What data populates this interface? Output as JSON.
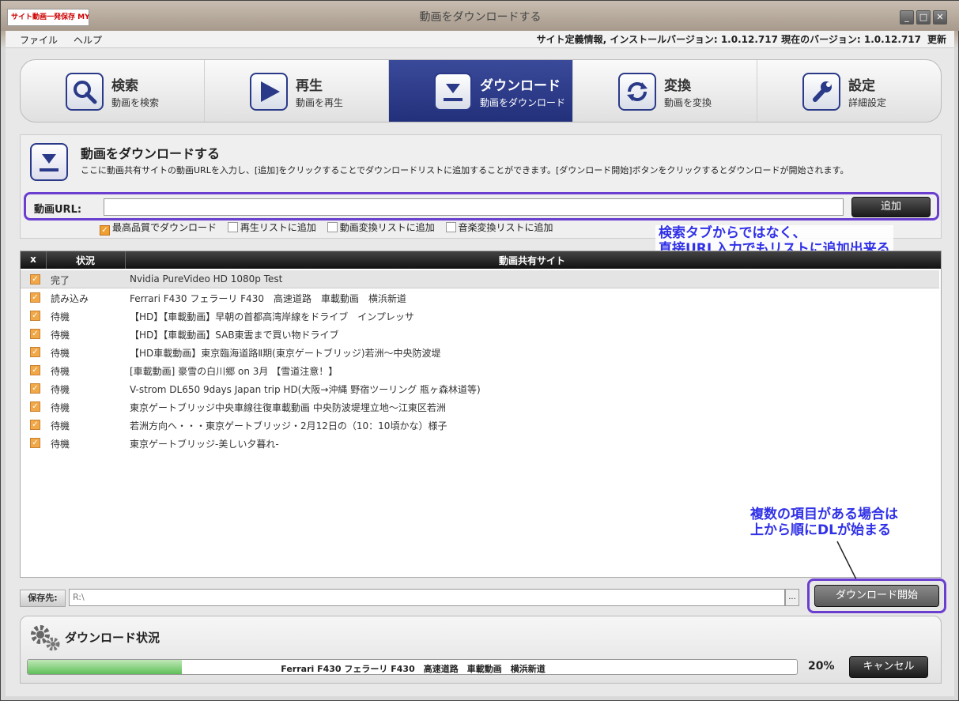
{
  "window": {
    "logo_text": "サイト動画一発保存 MY-DOGA!",
    "title": "動画をダウンロードする",
    "controls": {
      "minimize": "_",
      "maximize": "□",
      "close": "✕"
    }
  },
  "menu": {
    "file": "ファイル",
    "help": "ヘルプ",
    "version_info": "サイト定義情報, インストールバージョン: 1.0.12.717 現在のバージョン: 1.0.12.717",
    "update": "更新"
  },
  "tabs": [
    {
      "title": "検索",
      "sub": "動画を検索",
      "icon": "search-icon"
    },
    {
      "title": "再生",
      "sub": "動画を再生",
      "icon": "play-icon"
    },
    {
      "title": "ダウンロード",
      "sub": "動画をダウンロード",
      "icon": "download-icon",
      "active": true
    },
    {
      "title": "変換",
      "sub": "動画を変換",
      "icon": "convert-icon"
    },
    {
      "title": "設定",
      "sub": "詳細設定",
      "icon": "wrench-icon"
    }
  ],
  "panel": {
    "title": "動画をダウンロードする",
    "description": "ここに動画共有サイトの動画URLを入力し、[追加]をクリックすることでダウンロードリストに追加することができます。[ダウンロード開始]ボタンをクリックするとダウンロードが開始されます。",
    "url_label": "動画URL:",
    "url_value": "",
    "add_button": "追加"
  },
  "options": [
    {
      "label": "最高品質でダウンロード",
      "checked": true
    },
    {
      "label": "再生リストに追加",
      "checked": false
    },
    {
      "label": "動画変換リストに追加",
      "checked": false
    },
    {
      "label": "音楽変換リストに追加",
      "checked": false
    }
  ],
  "annotations": {
    "top_line1": "検索タブからではなく、",
    "top_line2": "直接URL入力でもリストに追加出来る",
    "bottom_line1": "複数の項目がある場合は",
    "bottom_line2": "上から順にDLが始まる"
  },
  "list": {
    "headers": {
      "x": "x",
      "status": "状況",
      "site": "動画共有サイト"
    },
    "rows": [
      {
        "status": "完了",
        "title": "Nvidia PureVideo HD 1080p Test"
      },
      {
        "status": "読み込み",
        "title": "Ferrari F430 フェラーリ F430　高速道路　車載動画　横浜新道"
      },
      {
        "status": "待機",
        "title": "【HD】【車載動画】早朝の首都高湾岸線をドライブ　インプレッサ"
      },
      {
        "status": "待機",
        "title": "【HD】【車載動画】SAB東雲まで買い物ドライブ"
      },
      {
        "status": "待機",
        "title": "【HD車載動画】東京臨海道路Ⅱ期(東京ゲートブリッジ)若洲～中央防波堤"
      },
      {
        "status": "待機",
        "title": "[車載動画] 豪雪の白川郷 on 3月 【雪道注意！】"
      },
      {
        "status": "待機",
        "title": "V-strom DL650 9days Japan trip HD(大阪→沖縄 野宿ツーリング 瓶ヶ森林道等)"
      },
      {
        "status": "待機",
        "title": "東京ゲートブリッジ中央車線往復車載動画 中央防波堤埋立地～江東区若洲"
      },
      {
        "status": "待機",
        "title": "若洲方向へ・・・東京ゲートブリッジ・2月12日の（10：10頃かな）様子"
      },
      {
        "status": "待機",
        "title": "東京ゲートブリッジ-美しい夕暮れ-"
      }
    ]
  },
  "save": {
    "label": "保存先:",
    "path": "R:\\",
    "browse": "..."
  },
  "download_button": "ダウンロード開始",
  "status": {
    "title": "ダウンロード状況",
    "current": "Ferrari F430 フェラーリ F430　高速道路　車載動画　横浜新道",
    "progress": 0.2,
    "percent": "20%",
    "cancel": "キャンセル"
  }
}
